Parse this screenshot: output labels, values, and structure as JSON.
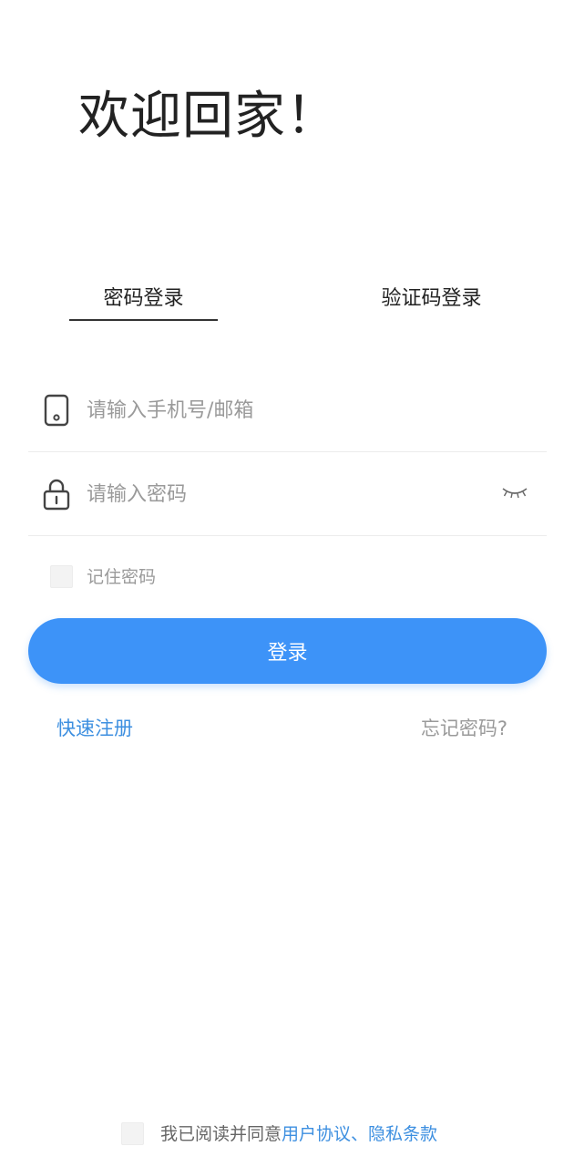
{
  "header": {
    "welcome_title": "欢迎回家！"
  },
  "tabs": [
    {
      "label": "密码登录",
      "active": true
    },
    {
      "label": "验证码登录",
      "active": false
    }
  ],
  "form": {
    "phone": {
      "placeholder": "请输入手机号/邮箱",
      "value": "",
      "icon": "phone-icon"
    },
    "password": {
      "placeholder": "请输入密码",
      "value": "",
      "icon": "lock-icon",
      "toggle_icon": "eye-closed-icon"
    },
    "remember": {
      "label": "记住密码",
      "checked": false
    },
    "login_label": "登录"
  },
  "links": {
    "register": "快速注册",
    "forgot": "忘记密码?"
  },
  "agreement": {
    "checked": false,
    "prefix": "我已阅读并同意",
    "user_agreement": "用户协议",
    "separator": "、",
    "privacy_terms": "隐私条款"
  },
  "colors": {
    "accent": "#3d93f8",
    "link": "#3d8fe0",
    "placeholder": "#9a9a9a"
  }
}
